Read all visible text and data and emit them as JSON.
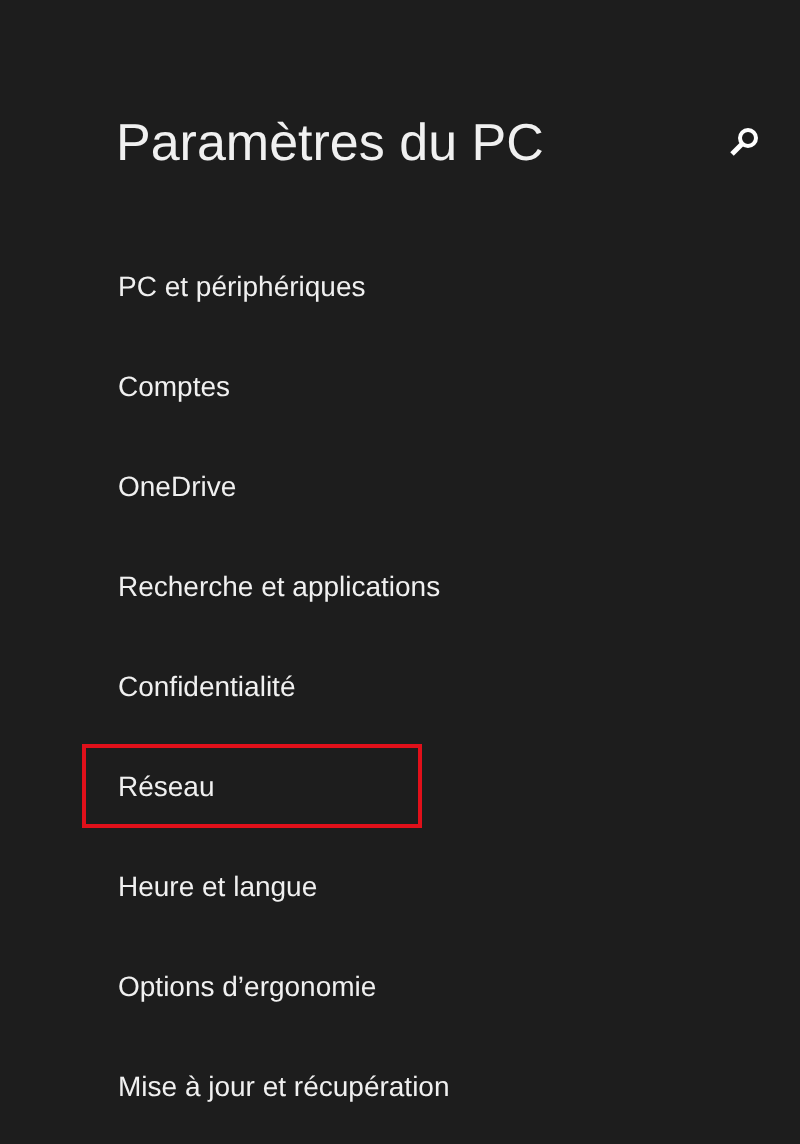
{
  "title": "Paramètres du PC",
  "items": [
    {
      "label": "PC et périphériques",
      "highlighted": false
    },
    {
      "label": "Comptes",
      "highlighted": false
    },
    {
      "label": "OneDrive",
      "highlighted": false
    },
    {
      "label": "Recherche et applications",
      "highlighted": false
    },
    {
      "label": "Confidentialité",
      "highlighted": false
    },
    {
      "label": "Réseau",
      "highlighted": true
    },
    {
      "label": "Heure et langue",
      "highlighted": false
    },
    {
      "label": "Options d’ergonomie",
      "highlighted": false
    },
    {
      "label": "Mise à jour et récupération",
      "highlighted": false
    }
  ]
}
